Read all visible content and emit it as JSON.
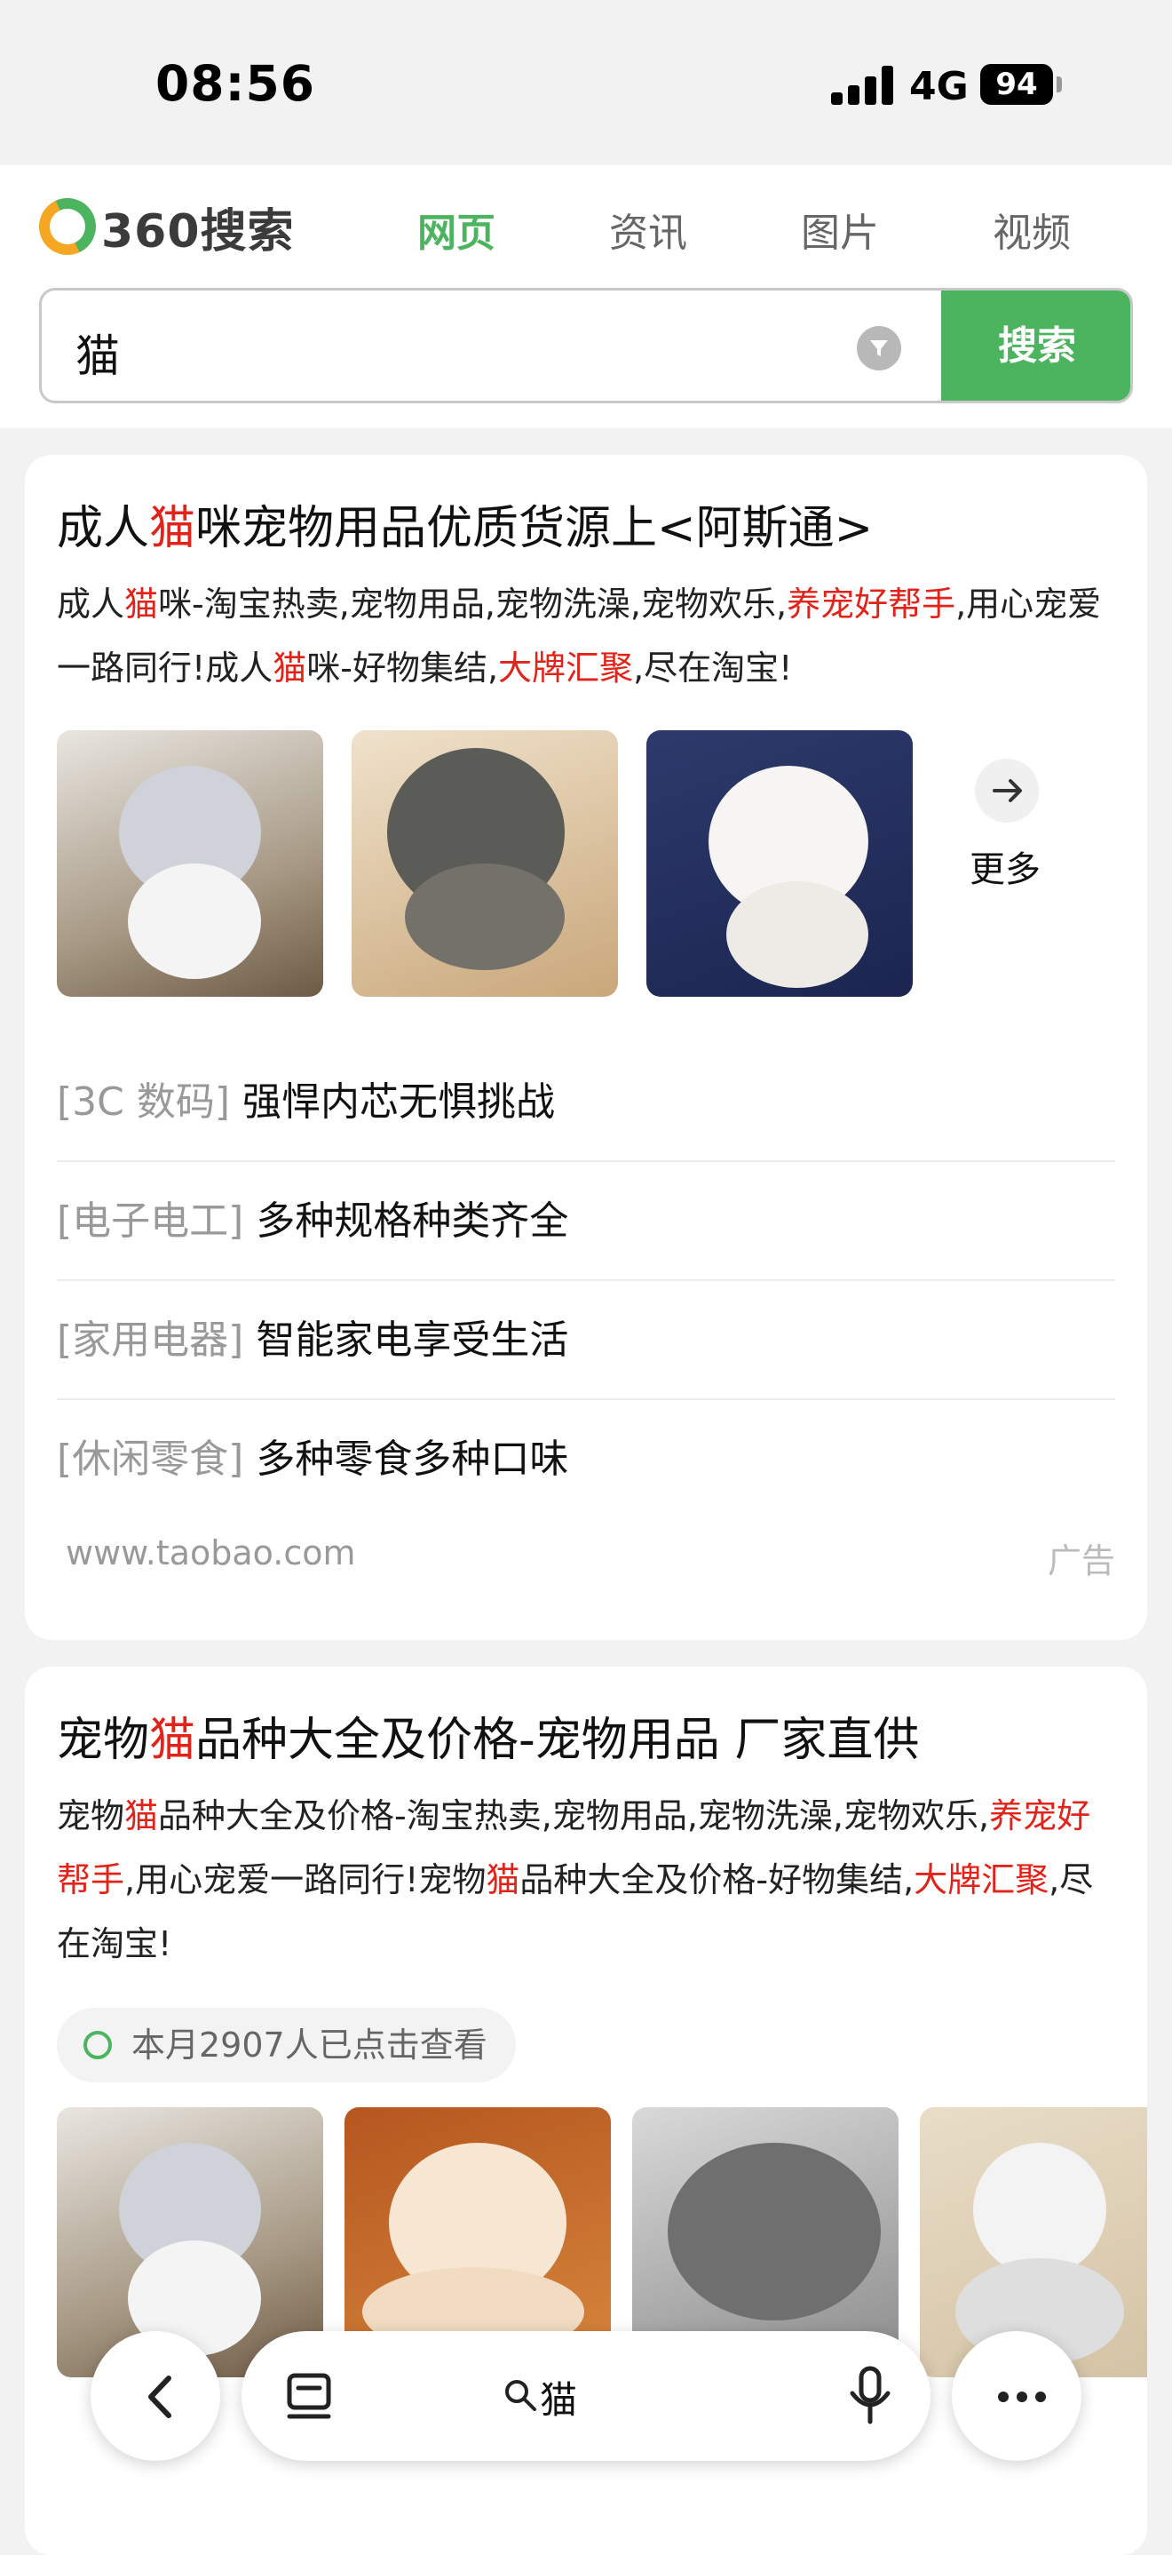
{
  "status_bar": {
    "time": "08:56",
    "network": "4G",
    "battery": "94"
  },
  "header": {
    "logo_text": "360搜索",
    "tabs": [
      {
        "label": "网页",
        "active": true
      },
      {
        "label": "资讯",
        "active": false
      },
      {
        "label": "图片",
        "active": false
      },
      {
        "label": "视频",
        "active": false
      }
    ]
  },
  "search": {
    "query": "猫",
    "button_label": "搜索"
  },
  "results": [
    {
      "title_parts": [
        "成人",
        "猫",
        "咪宠物用品优质货源上<阿斯通>"
      ],
      "desc_parts": [
        "成人",
        "猫",
        "咪-淘宝热卖,宠物用品,宠物洗澡,宠物欢乐,",
        "养宠好帮手",
        ",用心宠爱一路同行!成人",
        "猫",
        "咪-好物集结,",
        "大牌汇聚",
        ",尽在淘宝!"
      ],
      "more_label": "更多",
      "sublinks": [
        {
          "category": "[3C 数码]",
          "text": "强悍内芯无惧挑战"
        },
        {
          "category": "[电子电工]",
          "text": "多种规格种类齐全"
        },
        {
          "category": "[家用电器]",
          "text": "智能家电享受生活"
        },
        {
          "category": "[休闲零食]",
          "text": "多种零食多种口味"
        }
      ],
      "site": "www.taobao.com",
      "ad_label": "广告"
    },
    {
      "title_parts": [
        "宠物",
        "猫",
        "品种大全及价格-宠物用品 厂家直供"
      ],
      "desc_parts": [
        "宠物",
        "猫",
        "品种大全及价格-淘宝热卖,宠物用品,宠物洗澡,宠物欢乐,",
        "养宠好帮手",
        ",用心宠爱一路同行!宠物",
        "猫",
        "品种大全及价格-好物集结,",
        "大牌汇聚",
        ",尽在淘宝!"
      ],
      "badge": "本月2907人已点击查看"
    }
  ],
  "toolbar": {
    "query": "猫"
  },
  "colors": {
    "accent_green": "#4cb45e",
    "highlight_red": "#e2231a",
    "muted_gray": "#999999"
  },
  "icons": [
    "back-arrow-icon",
    "tabs-list-icon",
    "search-icon",
    "microphone-icon",
    "more-dots-icon",
    "filter-icon",
    "arrow-right-icon"
  ]
}
